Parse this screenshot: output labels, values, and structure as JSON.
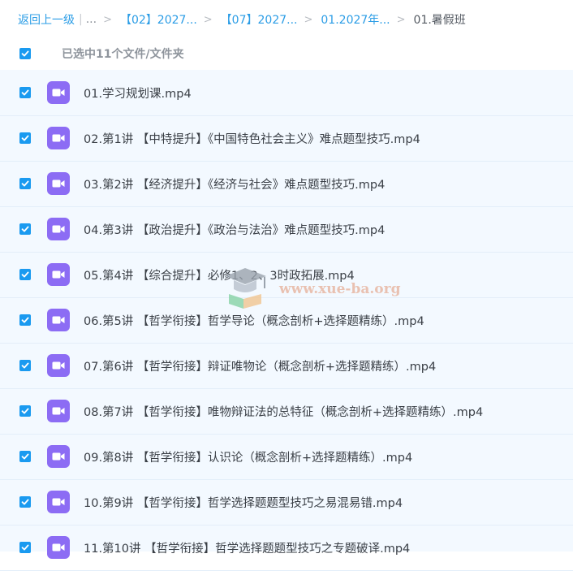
{
  "breadcrumb": {
    "back": "返回上一级",
    "ellipsis": "...",
    "items": [
      "【02】2027...",
      "【07】2027...",
      "01.2027年..."
    ],
    "current": "01.暑假班"
  },
  "selection": {
    "text": "已选中11个文件/文件夹",
    "checked": true
  },
  "files": [
    {
      "name": "01.学习规划课.mp4",
      "checked": true
    },
    {
      "name": "02.第1讲 【中特提升】《中国特色社会主义》难点题型技巧.mp4",
      "checked": true
    },
    {
      "name": "03.第2讲 【经济提升】《经济与社会》难点题型技巧.mp4",
      "checked": true
    },
    {
      "name": "04.第3讲 【政治提升】《政治与法治》难点题型技巧.mp4",
      "checked": true
    },
    {
      "name": "05.第4讲 【综合提升】必修1、2、3时政拓展.mp4",
      "checked": true
    },
    {
      "name": "06.第5讲 【哲学衔接】哲学导论（概念剖析+选择题精练）.mp4",
      "checked": true
    },
    {
      "name": "07.第6讲 【哲学衔接】辩证唯物论（概念剖析+选择题精练）.mp4",
      "checked": true
    },
    {
      "name": "08.第7讲 【哲学衔接】唯物辩证法的总特征（概念剖析+选择题精练）.mp4",
      "checked": true
    },
    {
      "name": "09.第8讲 【哲学衔接】认识论（概念剖析+选择题精练）.mp4",
      "checked": true
    },
    {
      "name": "10.第9讲 【哲学衔接】哲学选择题题型技巧之易混易错.mp4",
      "checked": true
    },
    {
      "name": "11.第10讲 【哲学衔接】哲学选择题题型技巧之专题破译.mp4",
      "checked": true
    }
  ],
  "file_icon": "video-file-icon",
  "watermark": {
    "text": "www.xue-ba.org",
    "icon": "graduation-cap-icon"
  },
  "colors": {
    "link": "#2b9de6",
    "checkbox": "#1a9af0",
    "video_icon": "#8c6cf4",
    "list_bg": "#f3f9ff"
  }
}
